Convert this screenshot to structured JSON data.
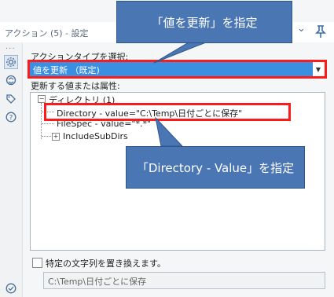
{
  "header": {
    "title": "アクション (5) - 設定"
  },
  "form": {
    "action_type_label": "アクションタイプを選択:",
    "action_type_value": "値を更新 （既定)",
    "values_label": "更新する値または属性:"
  },
  "tree": {
    "root": "ディレクトリ (1)",
    "children": [
      "Directory - value=\"C:\\Temp\\日付ごとに保存\"",
      "FileSpec - value=\"*.*\"",
      "IncludeSubDirs"
    ]
  },
  "replace": {
    "checkbox_label": "特定の文字列を置き換えます。",
    "input_value": "C:\\Temp\\日付ごとに保存"
  },
  "callouts": {
    "top": "「値を更新」を指定",
    "bottom": "「Directory - Value」を指定"
  },
  "colors": {
    "selection": "#3b8fe0",
    "callout": "#4a76b4",
    "highlight": "#ff1a1a"
  }
}
